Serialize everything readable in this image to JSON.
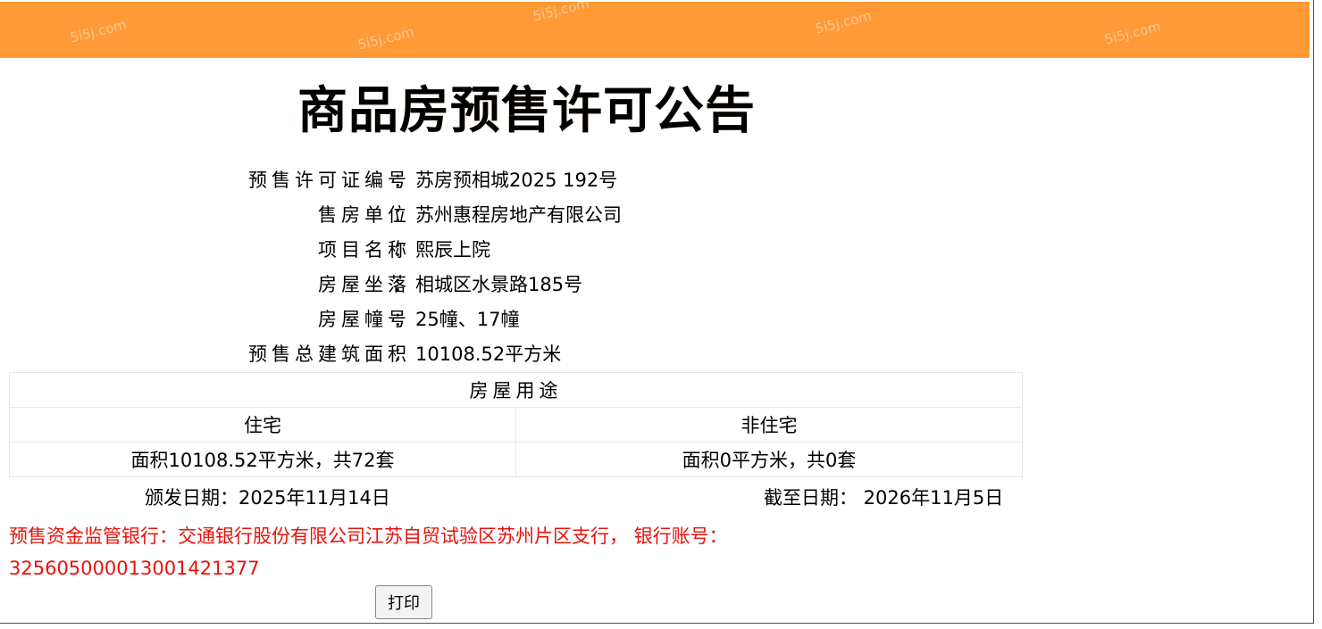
{
  "title": "商品房预售许可公告",
  "watermark": "5i5j.com",
  "fields": [
    {
      "label": "预售许可证编号",
      "value": "苏房预相城2025 192号"
    },
    {
      "label": "售房单位",
      "value": "苏州惠程房地产有限公司"
    },
    {
      "label": "项目名称",
      "value": "熙辰上院"
    },
    {
      "label": "房屋坐落",
      "value": "相城区水景路185号"
    },
    {
      "label": "房屋幢号",
      "value": "25幢、17幢"
    },
    {
      "label": "预售总建筑面积",
      "value": "10108.52平方米"
    }
  ],
  "colon": "：",
  "usage": {
    "title": "房屋用途",
    "residential": {
      "header": "住宅",
      "value": "面积10108.52平方米，共72套"
    },
    "nonresidential": {
      "header": "非住宅",
      "value": "面积0平方米，共0套"
    }
  },
  "issue_date": "颁发日期：2025年11月14日",
  "expiry_date": "截至日期： 2026年11月5日",
  "bank_info": "预售资金监管银行：交通银行股份有限公司江苏自贸试验区苏州片区支行， 银行账号：3256050000130014213​77",
  "print_label": "打印",
  "colors": {
    "banner": "#ff9a36",
    "bank_text": "#e8120c"
  }
}
